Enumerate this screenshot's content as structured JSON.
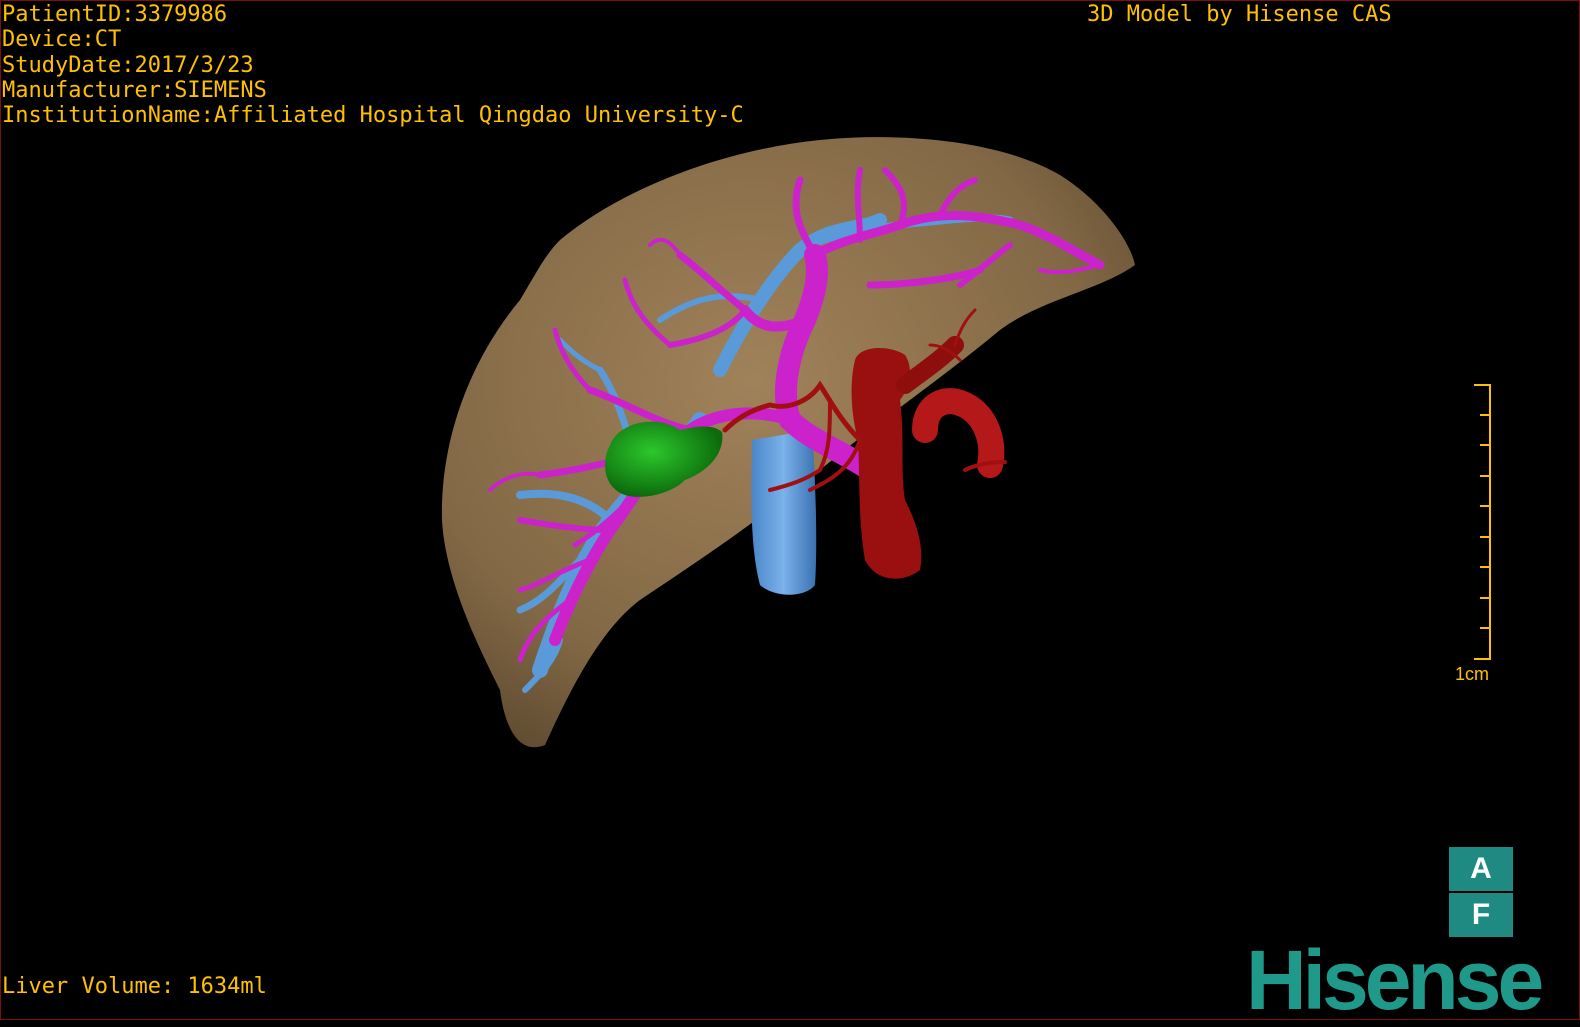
{
  "header": {
    "patient_id": "PatientID:3379986",
    "device": "Device:CT",
    "study_date": "StudyDate:2017/3/23",
    "manufacturer": "Manufacturer:SIEMENS",
    "institution": "InstitutionName:Affiliated Hospital Qingdao University-C"
  },
  "brand_caption": "3D Model by Hisense CAS",
  "footer": {
    "liver_volume": "Liver Volume: 1634ml"
  },
  "scale_bar": {
    "label": "1cm"
  },
  "orientation": {
    "top_label": "A",
    "bottom_label": "F"
  },
  "logo": {
    "text": "Hisense"
  },
  "colors": {
    "overlay_text": "#ffc000",
    "liver": "#8a6f4a",
    "portal_vein": "#cc22cc",
    "hepatic_vein": "#5a9ad8",
    "artery": "#a01010",
    "gallbladder": "#1a9a1a",
    "brand_teal": "#1f8a82"
  }
}
